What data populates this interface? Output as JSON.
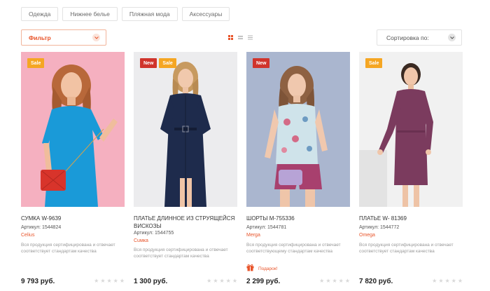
{
  "categories": [
    "Одежда",
    "Нижнее белье",
    "Пляжная мода",
    "Аксессуары"
  ],
  "filter": {
    "label": "Фильтр"
  },
  "view_modes": [
    "grid-view-icon",
    "list-view-icon",
    "compact-list-view-icon"
  ],
  "sort": {
    "label": "Сортировка по:"
  },
  "colors": {
    "accent": "#e8542a",
    "sale": "#f5a623",
    "new": "#d0342c"
  },
  "products": [
    {
      "badges": [
        "Sale"
      ],
      "title": "СУМКА W-9639",
      "sku": "Артикул: 1544824",
      "brand": "Celius",
      "description": "Вся продукция сертифицирована и отвечает соответствует стандартам качества",
      "gift": "",
      "price": "9 793 руб.",
      "rating": 0
    },
    {
      "badges": [
        "New",
        "Sale"
      ],
      "title": "ПЛАТЬЕ ДЛИННОЕ ИЗ СТРУЯЩЕЙСЯ ВИСКОЗЫ",
      "sku": "Артикул: 1544755",
      "brand": "Cuмка",
      "description": "Вся продукция сертифицирована и отвечает соответствует стандартам качества",
      "gift": "",
      "price": "1 300 руб.",
      "rating": 0
    },
    {
      "badges": [
        "New"
      ],
      "title": "ШОРТЫ M-755336",
      "sku": "Артикул: 1544781",
      "brand": "Merga",
      "description": "Вся продукция сертифицирована и отвечает соответствующему стандартам качества",
      "gift": "Подарок!",
      "price": "2 299 руб.",
      "rating": 0
    },
    {
      "badges": [
        "Sale"
      ],
      "title": "ПЛАТЬЕ W- 81369",
      "sku": "Артикул: 1544772",
      "brand": "Omega",
      "description": "Вся продукция сертифицирована и отвечает соответствует стандартам качества",
      "gift": "",
      "price": "7 820 руб.",
      "rating": 0
    }
  ]
}
